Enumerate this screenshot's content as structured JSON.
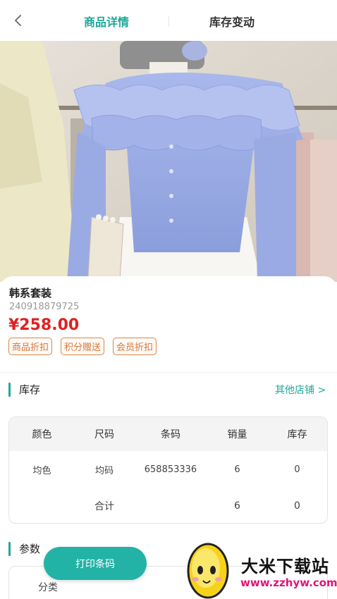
{
  "header": {
    "tabs": [
      {
        "label": "商品详情",
        "active": true
      },
      {
        "label": "库存变动",
        "active": false
      }
    ]
  },
  "product": {
    "name": "韩系套装",
    "sku": "240918879725",
    "price": "¥258.00",
    "tags": [
      "商品折扣",
      "积分赠送",
      "会员折扣"
    ]
  },
  "stock_section": {
    "title": "库存",
    "other_shops": "其他店铺 >"
  },
  "stock_table": {
    "headers": [
      "颜色",
      "尺码",
      "条码",
      "销量",
      "库存"
    ],
    "rows": [
      [
        "均色",
        "均码",
        "658853336",
        "6",
        "0"
      ]
    ],
    "total": [
      "",
      "合计",
      "",
      "6",
      "0"
    ]
  },
  "params_section": {
    "title": "参数",
    "first_label": "分类"
  },
  "actions": {
    "print_label": "打印条码"
  },
  "watermark": {
    "name": "大米下载站",
    "url": "www.zzhyw.com"
  },
  "colors": {
    "accent": "#1fa89b",
    "price": "#e02020",
    "tag": "#d6763a"
  }
}
